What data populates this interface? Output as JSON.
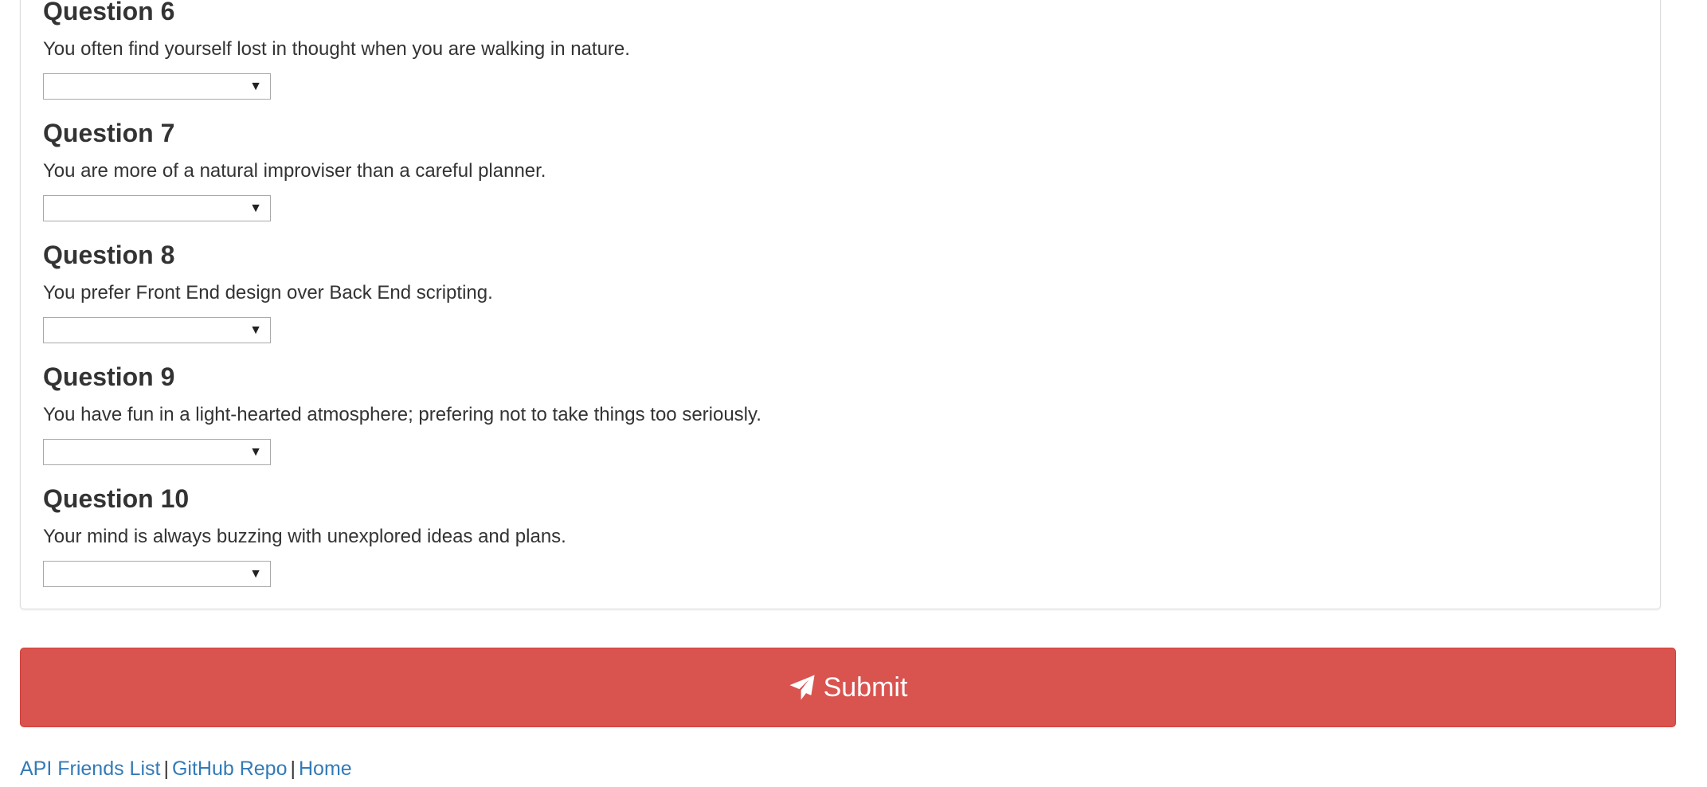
{
  "questions": [
    {
      "heading": "Question 6",
      "text": "You often find yourself lost in thought when you are walking in nature.",
      "value": ""
    },
    {
      "heading": "Question 7",
      "text": "You are more of a natural improviser than a careful planner.",
      "value": ""
    },
    {
      "heading": "Question 8",
      "text": "You prefer Front End design over Back End scripting.",
      "value": ""
    },
    {
      "heading": "Question 9",
      "text": "You have fun in a light-hearted atmosphere; prefering not to take things too seriously.",
      "value": ""
    },
    {
      "heading": "Question 10",
      "text": "Your mind is always buzzing with unexplored ideas and plans.",
      "value": ""
    }
  ],
  "submit": {
    "label": "Submit",
    "icon": "send-icon",
    "color": "#d9534f"
  },
  "footer": {
    "links": [
      {
        "label": "API Friends List"
      },
      {
        "label": "GitHub Repo"
      },
      {
        "label": "Home"
      }
    ],
    "separator": "|",
    "link_color": "#337ab7"
  }
}
